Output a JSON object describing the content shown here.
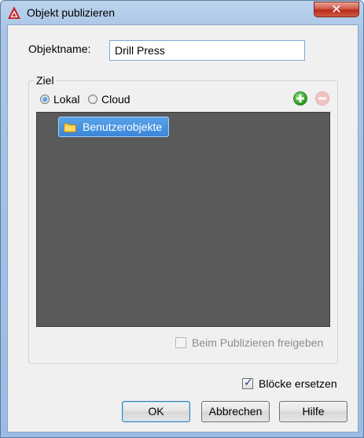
{
  "window": {
    "title": "Objekt publizieren",
    "close_glyph": "✕"
  },
  "form": {
    "name_label": "Objektname:",
    "name_value": "Drill Press"
  },
  "target": {
    "group_label": "Ziel",
    "options": [
      {
        "label": "Lokal",
        "checked": true
      },
      {
        "label": "Cloud",
        "checked": false
      }
    ],
    "add_icon": "plus-green-circle",
    "remove_icon": "minus-red-circle-disabled",
    "tree": {
      "items": [
        {
          "label": "Benutzerobjekte",
          "icon": "folder-icon",
          "selected": true
        }
      ]
    },
    "share_checkbox": {
      "label": "Beim Publizieren freigeben",
      "checked": false,
      "enabled": false
    }
  },
  "replace_blocks": {
    "label": "Blöcke ersetzen",
    "checked": true
  },
  "buttons": {
    "ok": "OK",
    "cancel": "Abbrechen",
    "help": "Hilfe"
  },
  "colors": {
    "tree_bg": "#5a5a5a",
    "selection": "#3a86d8",
    "close": "#c7432f",
    "add": "#2fa624"
  }
}
